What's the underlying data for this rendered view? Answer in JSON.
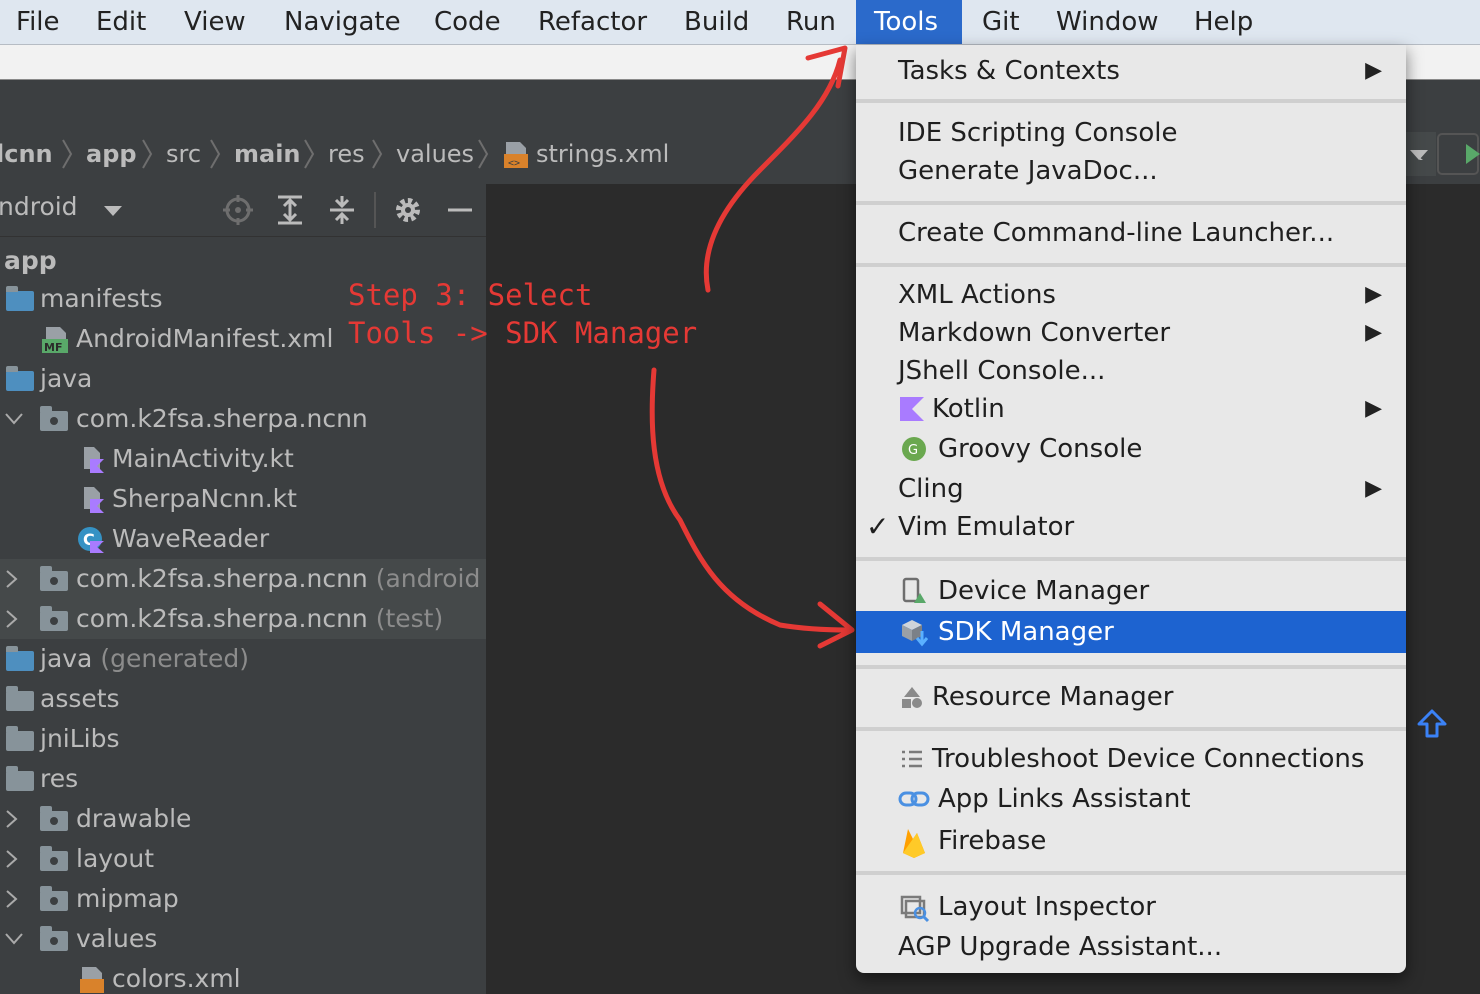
{
  "menubar": {
    "items": [
      "File",
      "Edit",
      "View",
      "Navigate",
      "Code",
      "Refactor",
      "Build",
      "Run",
      "Tools",
      "Git",
      "Window",
      "Help"
    ],
    "active": "Tools"
  },
  "breadcrumb": {
    "items": [
      "lcnn",
      "app",
      "src",
      "main",
      "res",
      "values",
      "strings.xml"
    ]
  },
  "project_header": {
    "view": "ndroid"
  },
  "tree": [
    {
      "label": "app"
    },
    {
      "label": "manifests"
    },
    {
      "label": "AndroidManifest.xml"
    },
    {
      "label": "java"
    },
    {
      "label": "com.k2fsa.sherpa.ncnn"
    },
    {
      "label": "MainActivity.kt"
    },
    {
      "label": "SherpaNcnn.kt"
    },
    {
      "label": "WaveReader"
    },
    {
      "label": "com.k2fsa.sherpa.ncnn",
      "suffix": "(android"
    },
    {
      "label": "com.k2fsa.sherpa.ncnn",
      "suffix": "(test)"
    },
    {
      "label": "java",
      "suffix": "(generated)"
    },
    {
      "label": "assets"
    },
    {
      "label": "jniLibs"
    },
    {
      "label": "res"
    },
    {
      "label": "drawable"
    },
    {
      "label": "layout"
    },
    {
      "label": "mipmap"
    },
    {
      "label": "values"
    },
    {
      "label": "colors.xml"
    }
  ],
  "annotation": {
    "line1": "Step 3: Select",
    "line2": "Tools -> SDK Manager"
  },
  "menu": {
    "items": [
      {
        "label": "Tasks & Contexts",
        "submenu": "▶"
      },
      {
        "label": "IDE Scripting Console"
      },
      {
        "label": "Generate JavaDoc..."
      },
      {
        "label": "Create Command-line Launcher..."
      },
      {
        "label": "XML Actions",
        "submenu": "▶"
      },
      {
        "label": "Markdown Converter",
        "submenu": "▶"
      },
      {
        "label": "JShell Console..."
      },
      {
        "label": "Kotlin",
        "submenu": "▶"
      },
      {
        "label": "Groovy Console"
      },
      {
        "label": "Cling",
        "submenu": "▶"
      },
      {
        "label": "Vim Emulator",
        "check": "✓"
      },
      {
        "label": "Device Manager"
      },
      {
        "label": "SDK Manager",
        "selected": true
      },
      {
        "label": "Resource Manager"
      },
      {
        "label": "Troubleshoot Device Connections"
      },
      {
        "label": "App Links Assistant"
      },
      {
        "label": "Firebase"
      },
      {
        "label": "Layout Inspector"
      },
      {
        "label": "AGP Upgrade Assistant..."
      }
    ]
  },
  "colors": {
    "accent": "#2b6acb",
    "selection": "#1d63d0",
    "annotation": "#e53935"
  }
}
